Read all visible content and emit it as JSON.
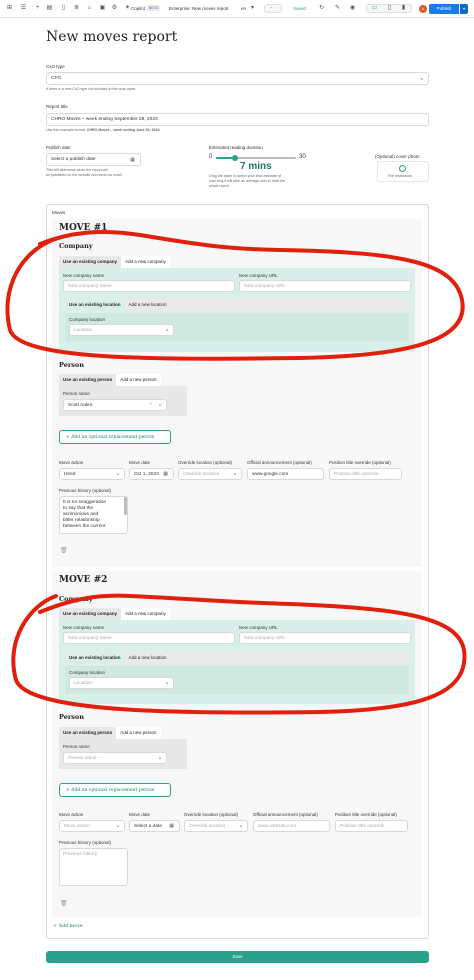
{
  "toolbar": {
    "copilot_label": "Copilot",
    "beta_badge": "BETA",
    "doc_title": "Enterprise: New moves report",
    "lang_value": "en",
    "saved_label": "Saved",
    "avatar_initial": "A",
    "publish_label": "Publish"
  },
  "page": {
    "title": "New moves report",
    "cxo_type": {
      "label": "CxO type",
      "value": "CFO",
      "hint": "If there is a new CxO type not included in the drop down"
    },
    "report_title": {
      "label": "Report title",
      "value": "CHRO Moves – week ending September 29, 2023",
      "hint_prefix": "Use this example format: ",
      "hint_example": "CHRO Moves – week ending June 30, 2023"
    },
    "publish_date": {
      "label": "Publish date",
      "placeholder": "Select a publish date",
      "hint_line1": "This will determine when the report will",
      "hint_line2": "be published on the website and send via email"
    },
    "reading": {
      "label": "Estimated reading duration",
      "min": "0",
      "max": "30",
      "value": 7,
      "value_text": "7 mins",
      "hint_line1": "Drag the slider to select your best estimate of",
      "hint_line2": "how long it will take an average user to read the",
      "hint_line3": "whole report."
    },
    "cover_photo": {
      "label": "(Optional) cover photo",
      "hint": "File restrictions"
    },
    "moves_label": "Moves",
    "add_moves_label": "+ Add move",
    "save_label": "Save"
  },
  "moves": [
    {
      "title": "MOVE #1",
      "company": {
        "heading": "Company",
        "tab_existing": "Use an existing company",
        "tab_new": "Add a new company",
        "name_label": "New company name",
        "name_placeholder": "New company name",
        "url_label": "New company URL",
        "url_placeholder": "New company URL",
        "loc_tab_existing": "Use an existing location",
        "loc_tab_new": "Add a new location",
        "loc_label": "Company location",
        "loc_placeholder": "Location"
      },
      "person": {
        "heading": "Person",
        "tab_existing": "Use an existing person",
        "tab_new": "Add a new person",
        "name_label": "Person name",
        "name_value": "Scott Aakre",
        "clear": "×",
        "add_replacement": "+ Add an optional replacement person"
      },
      "details": {
        "action_label": "Move action",
        "action_value": "Hired",
        "date_label": "Move date",
        "date_value": "Oct 1, 2023",
        "override_loc_label": "Override location (optional)",
        "override_loc_placeholder": "Override location",
        "announcement_label": "Official announcement (optional)",
        "announcement_value": "www.google.com",
        "position_label": "Position title override (optional)",
        "position_placeholder": "Position title override",
        "history_label": "Previous history (optional)",
        "history_lines": [
          "It is no exaggeration",
          "to say that the",
          "acrimonious and",
          "bitter relationship",
          "between the current"
        ]
      }
    },
    {
      "title": "MOVE #2",
      "company": {
        "heading": "Company",
        "tab_existing": "Use an existing company",
        "tab_new": "Add a new company",
        "name_label": "New company name",
        "name_placeholder": "New company name",
        "url_label": "New company URL",
        "url_placeholder": "New company URL",
        "loc_tab_existing": "Use an existing location",
        "loc_tab_new": "Add a new location",
        "loc_label": "Company location",
        "loc_placeholder": "Location"
      },
      "person": {
        "heading": "Person",
        "tab_existing": "Use an existing person",
        "tab_new": "Add a new person",
        "name_label": "Person name",
        "name_placeholder": "Person name",
        "add_replacement": "+ Add an optional replacement person"
      },
      "details": {
        "action_label": "Move action",
        "action_placeholder": "Move action",
        "date_label": "Move date",
        "date_placeholder": "Select a date",
        "override_loc_label": "Override location (optional)",
        "override_loc_placeholder": "Override location",
        "announcement_label": "Official announcement (optional)",
        "announcement_placeholder": "www.website.com",
        "position_label": "Position title override (optional)",
        "position_placeholder": "Position title override",
        "history_label": "Previous history (optional)",
        "history_placeholder": "Previous history"
      }
    }
  ],
  "colors": {
    "accent": "#2ba08a",
    "publish": "#1a7be3",
    "annotation": "#e0200c"
  }
}
